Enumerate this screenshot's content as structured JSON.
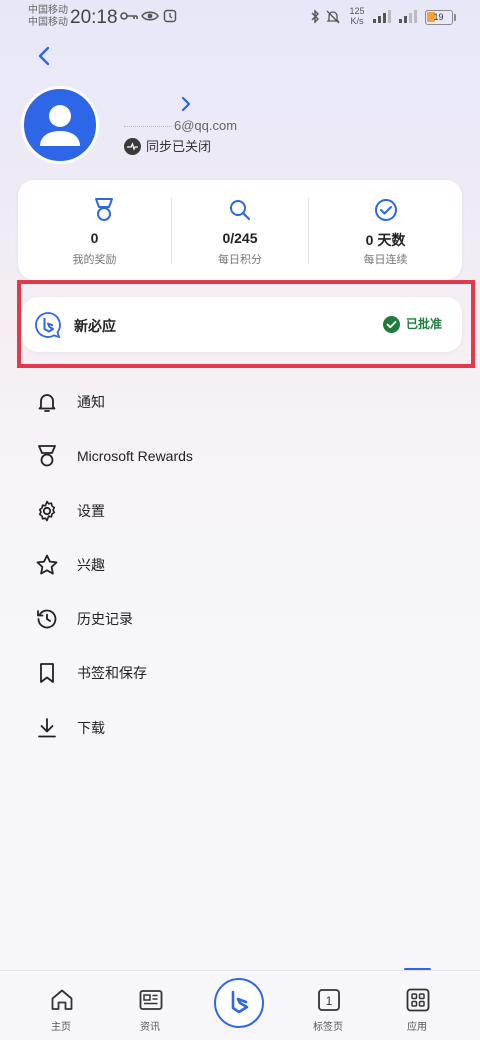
{
  "status_bar": {
    "carrier1": "中国移动",
    "carrier2": "中国移动",
    "time": "20:18",
    "net_speed_value": "125",
    "net_speed_unit": "K/s",
    "battery_level": "19"
  },
  "profile": {
    "email_visible": "6@qq.com",
    "sync_status": "同步已关闭"
  },
  "stats": [
    {
      "value": "0",
      "label": "我的奖励",
      "icon": "medal-icon"
    },
    {
      "value": "0/245",
      "label": "每日积分",
      "icon": "search-icon"
    },
    {
      "value": "0 天数",
      "label": "每日连续",
      "icon": "check-circle-icon"
    }
  ],
  "new_bing": {
    "label": "新必应",
    "status": "已批准"
  },
  "menu": [
    {
      "label": "通知",
      "icon": "bell-icon"
    },
    {
      "label": "Microsoft Rewards",
      "icon": "medal-icon"
    },
    {
      "label": "设置",
      "icon": "gear-icon"
    },
    {
      "label": "兴趣",
      "icon": "star-icon"
    },
    {
      "label": "历史记录",
      "icon": "history-icon"
    },
    {
      "label": "书签和保存",
      "icon": "bookmark-icon"
    },
    {
      "label": "下载",
      "icon": "download-icon"
    }
  ],
  "bottom_nav": {
    "home": "主页",
    "news": "资讯",
    "tabs": "标签页",
    "tabs_count": "1",
    "apps": "应用",
    "active": "应用"
  },
  "colors": {
    "accent": "#2d66e6",
    "approved": "#1e7d3a",
    "highlight": "#e23a4a"
  }
}
